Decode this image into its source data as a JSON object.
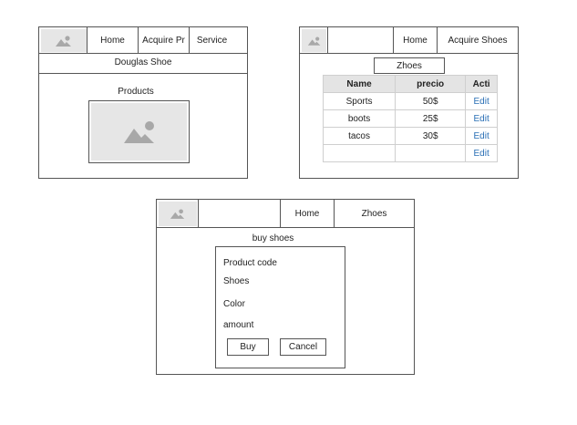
{
  "mockup1": {
    "nav": [
      "Home",
      "Acquire Pr",
      "Service"
    ],
    "title": "Douglas Shoe",
    "products_label": "Products"
  },
  "mockup2": {
    "nav": [
      "Home",
      "Acquire Shoes"
    ],
    "heading": "Zhoes",
    "table": {
      "columns": [
        "Name",
        "precio",
        "Acti"
      ],
      "rows": [
        [
          "Sports",
          "50$",
          "Edit"
        ],
        [
          "boots",
          "25$",
          "Edit"
        ],
        [
          "tacos",
          "30$",
          "Edit"
        ],
        [
          "",
          "",
          "Edit"
        ]
      ]
    }
  },
  "mockup3": {
    "nav": [
      "Home",
      "Zhoes"
    ],
    "title": "buy shoes",
    "fields": [
      "Product code",
      "Shoes",
      "Color",
      "amount"
    ],
    "buy_label": "Buy",
    "cancel_label": "Cancel"
  }
}
